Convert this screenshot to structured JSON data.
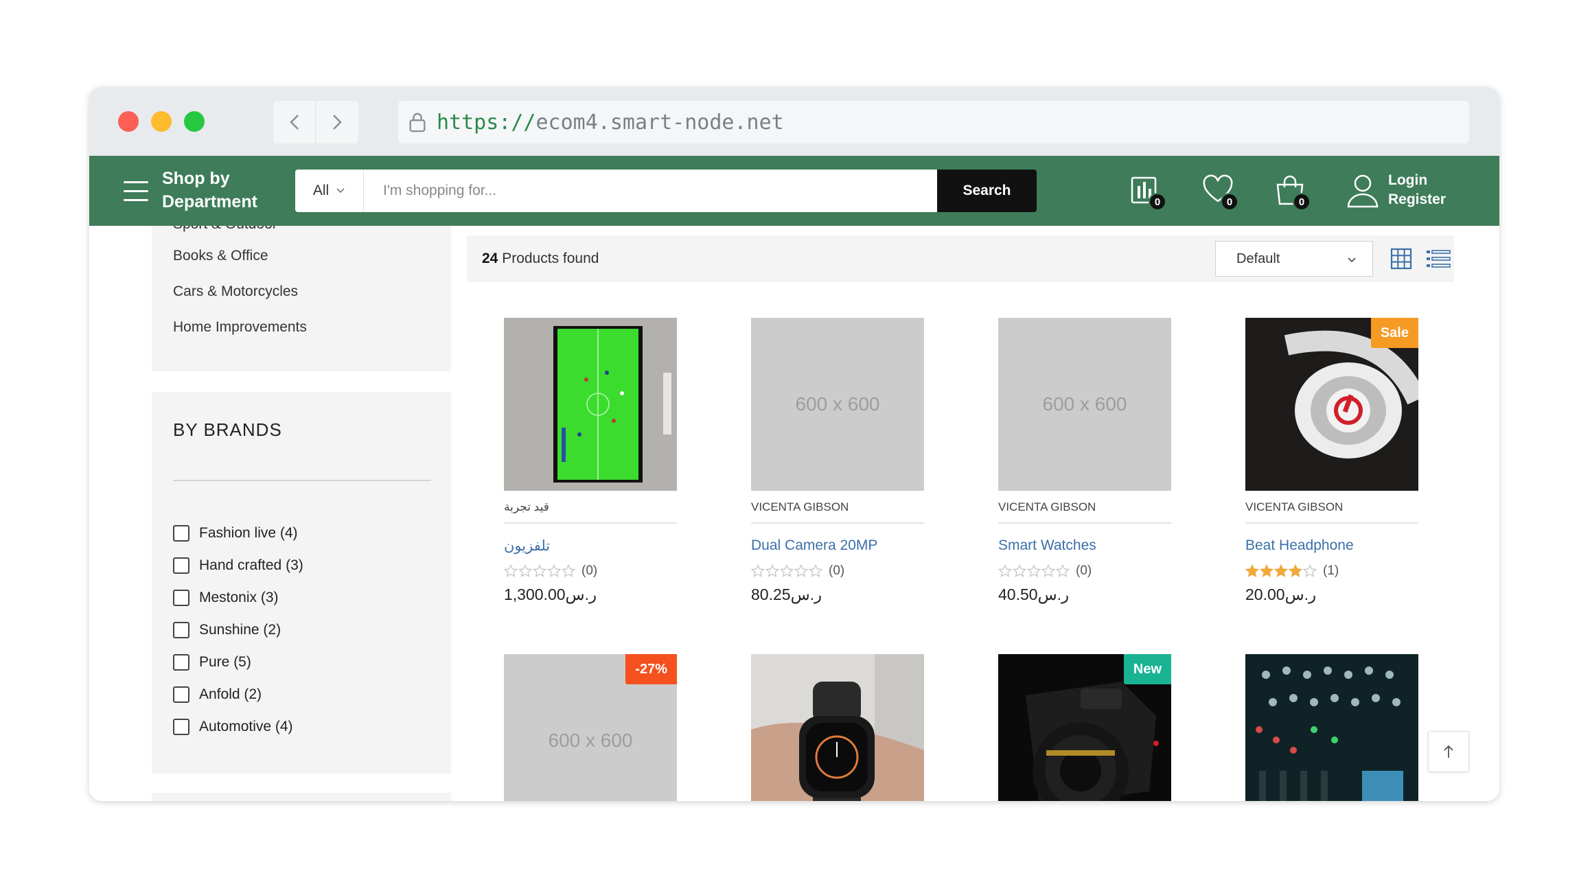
{
  "browser": {
    "url_scheme": "https://",
    "url_host": "ecom4.smart-node.net"
  },
  "header": {
    "department_line1": "Shop by",
    "department_line2": "Department",
    "category_select": "All",
    "search_placeholder": "I'm shopping for...",
    "search_button": "Search",
    "compare_count": "0",
    "wishlist_count": "0",
    "cart_count": "0",
    "login": "Login",
    "register": "Register",
    "brand_color": "#3e7c5a"
  },
  "sidebar": {
    "cut_item": "Sport & Outdoor",
    "categories": [
      "Books & Office",
      "Cars & Motorcycles",
      "Home Improvements"
    ],
    "brands_title": "BY BRANDS",
    "brands": [
      "Fashion live (4)",
      "Hand crafted (3)",
      "Mestonix (3)",
      "Sunshine (2)",
      "Pure (5)",
      "Anfold (2)",
      "Automotive (4)"
    ]
  },
  "toolbar": {
    "count": "24",
    "found_label": "Products found",
    "sort_value": "Default"
  },
  "products": [
    {
      "image": "tv-football",
      "vendor": "قيد تجربة",
      "title": "تلفزيون",
      "rating_stars": 0,
      "reviews": "(0)",
      "price": "1,300.00ر.س"
    },
    {
      "image": "placeholder",
      "placeholder_text": "600 x 600",
      "vendor": "VICENTA GIBSON",
      "title": "Dual Camera 20MP",
      "rating_stars": 0,
      "reviews": "(0)",
      "price": "80.25ر.س"
    },
    {
      "image": "placeholder",
      "placeholder_text": "600 x 600",
      "vendor": "VICENTA GIBSON",
      "title": "Smart Watches",
      "rating_stars": 0,
      "reviews": "(0)",
      "price": "40.50ر.س"
    },
    {
      "image": "headphone",
      "badge": "Sale",
      "badge_color": "#f59a23",
      "vendor": "VICENTA GIBSON",
      "title": "Beat Headphone",
      "rating_stars": 4,
      "reviews": "(1)",
      "price": "20.00ر.س"
    },
    {
      "image": "placeholder",
      "placeholder_text": "600 x 600",
      "badge": "-27%",
      "badge_color": "#f4511e"
    },
    {
      "image": "smartwatch"
    },
    {
      "image": "camera",
      "badge": "New",
      "badge_color": "#19b394"
    },
    {
      "image": "mixer"
    }
  ]
}
